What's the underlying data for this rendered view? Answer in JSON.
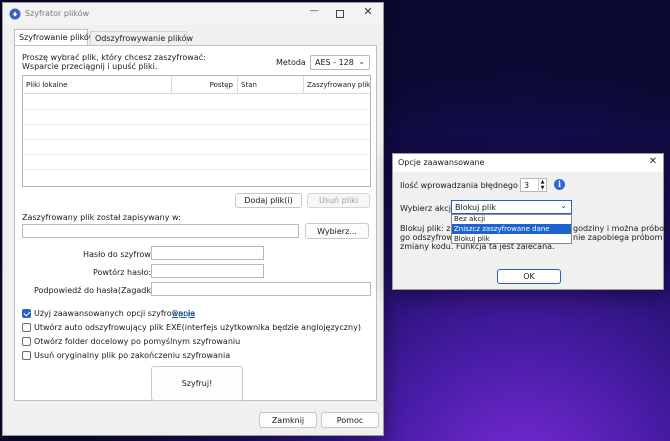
{
  "main_window": {
    "title": "Szyfrator plików",
    "tabs": [
      "Szyfrowanie plików",
      "Odszyfrowywanie plików"
    ],
    "instruction_line1": "Proszę wybrać plik, który chcesz zaszyfrować:",
    "instruction_line2": "Wsparcie przeciągnij i upuść pliki.",
    "method_label": "Metoda",
    "method_value": "AES - 128",
    "table_columns": [
      "Pliki lokalne",
      "Postęp",
      "Stan",
      "Zaszyfrowany plik"
    ],
    "add_file_label": "Dodaj plik(i)",
    "remove_file_label": "Usuń pliki",
    "saved_label": "Zaszyfrowany plik został zapisywany w:",
    "browse_label": "Wybierz...",
    "password_label": "Hasło do szyfrowania:",
    "repeat_label": "Powtórz hasło:",
    "hint_label": "Podpowiedź do hasła(Zagadka):",
    "advanced_label": "Użyj zaawansowanych opcji szyfrowania",
    "options_link": "Opcje",
    "exe_label": "Utwórz auto odszyfrowujący plik EXE(interfejs użytkownika będzie anglojęzyczny)",
    "open_folder_label": "Otwórz folder docelowy po pomyślnym szyfrowaniu",
    "delete_original_label": "Usuń oryginalny plik po zakończeniu szyfrowania",
    "encrypt_label": "Szyfruj!",
    "close_label": "Zamknij",
    "help_label": "Pomoc",
    "advanced_checked": true,
    "exe_checked": false,
    "open_folder_checked": false,
    "delete_original_checked": false
  },
  "advanced_dialog": {
    "title": "Opcje zaawansowane",
    "attempts_label": "Ilość wprowadzania błędnego hasła",
    "attempts_value": "3",
    "action_label": "Wybierz akcję",
    "action_value": "Blokuj plik",
    "dropdown_options": [
      "Bez akcji",
      "Zniszcz zaszyfrowane dane",
      "Blokuj plik"
    ],
    "dropdown_highlighted_index": 1,
    "desc_left_1": "Blokuj plik: zablo",
    "desc_left_2": "go odszyfrowan",
    "desc_right_1": "godziny i można próbować",
    "desc_right_2": "nie zapobiega próbom",
    "desc_line3": "zmiany kodu. Funkcja ta jest zalecana.",
    "ok_label": "OK"
  },
  "colors": {
    "accent": "#2c5fc4",
    "link": "#0a58c0",
    "highlight": "#1e64d0"
  }
}
